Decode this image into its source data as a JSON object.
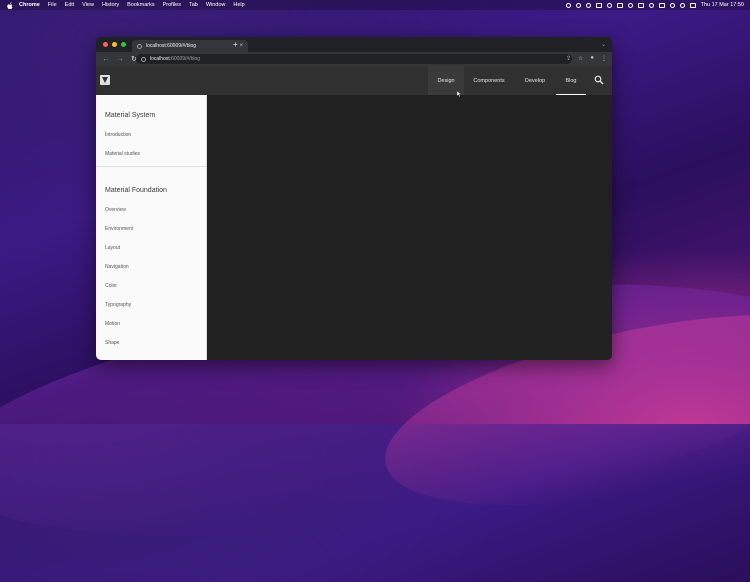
{
  "menubar": {
    "app": "Chrome",
    "items": [
      "File",
      "Edit",
      "View",
      "History",
      "Bookmarks",
      "Profiles",
      "Tab",
      "Window",
      "Help"
    ],
    "clock": "Thu 17 Mar  17:50"
  },
  "browser": {
    "tab_title": "localhost:60009/#/blog",
    "url_host": "localhost",
    "url_path": ":60009/#/blog"
  },
  "app": {
    "nav": [
      {
        "label": "Design"
      },
      {
        "label": "Components"
      },
      {
        "label": "Develop"
      },
      {
        "label": "Blog"
      }
    ],
    "sidebar": {
      "section1": {
        "title": "Material System",
        "items": [
          "Introduction",
          "Material studies"
        ]
      },
      "section2": {
        "title": "Material Foundation",
        "items": [
          "Overview",
          "Environment",
          "Layout",
          "Navigation",
          "Color",
          "Typography",
          "Motion",
          "Shape"
        ]
      }
    }
  }
}
